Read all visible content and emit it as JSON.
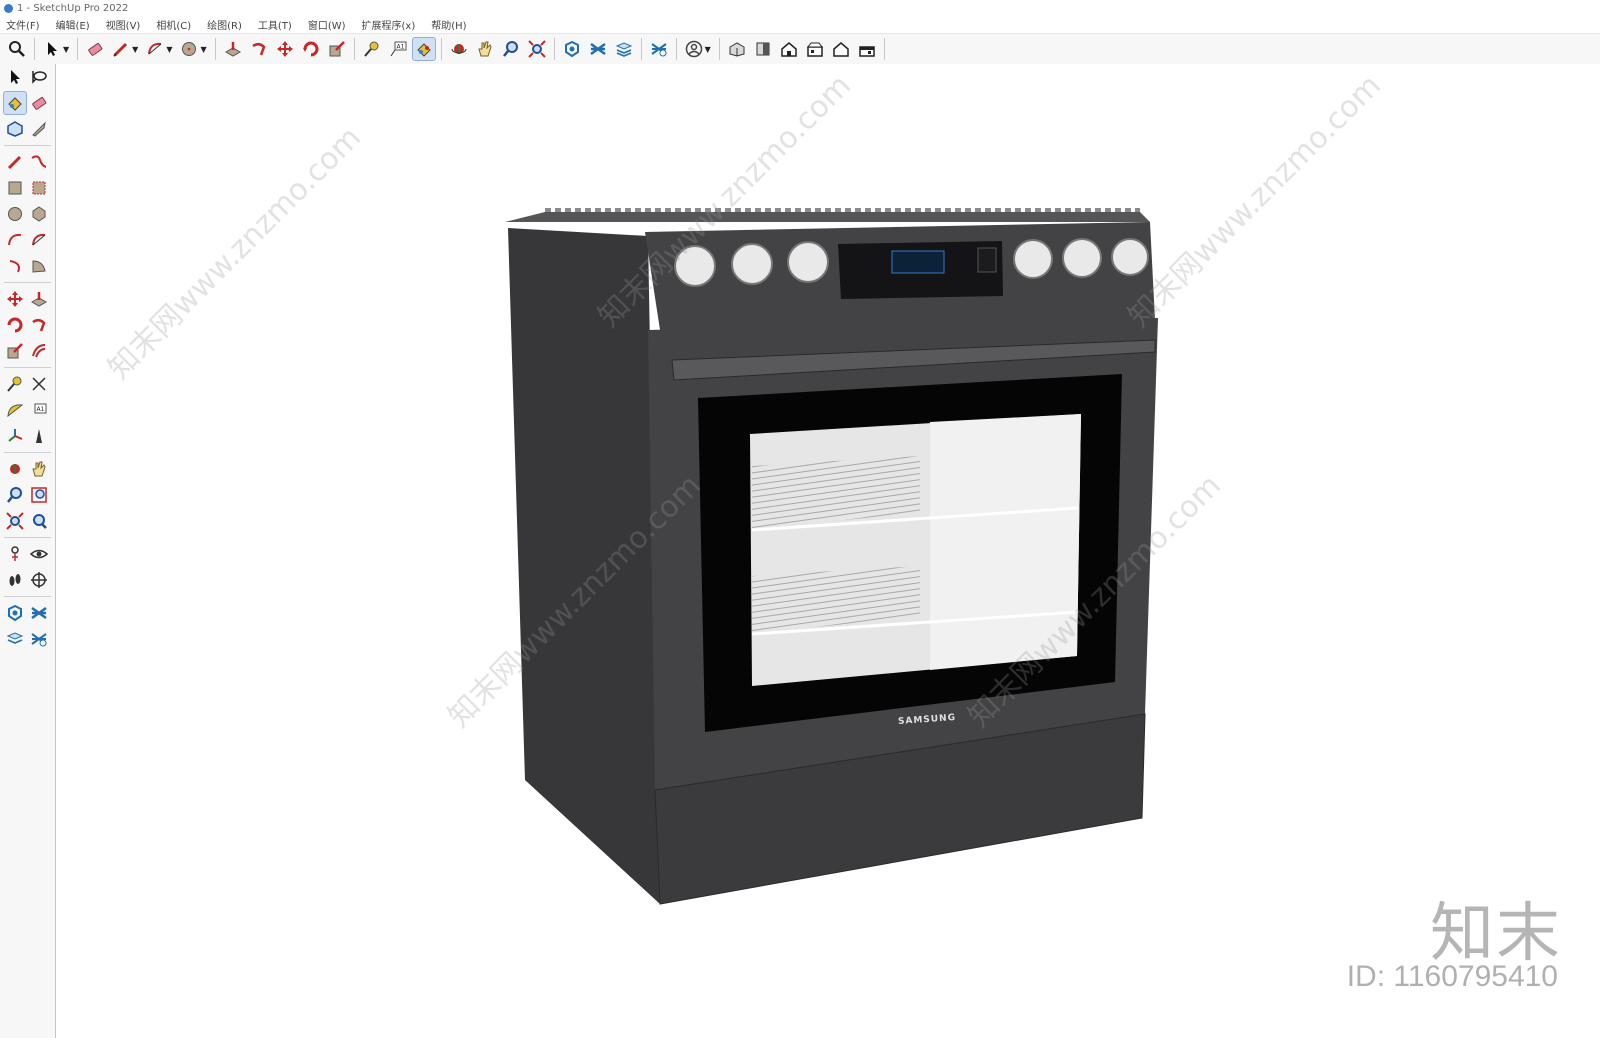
{
  "window": {
    "title": "1 - SketchUp Pro 2022"
  },
  "menu": [
    "文件(F)",
    "编辑(E)",
    "视图(V)",
    "相机(C)",
    "绘图(R)",
    "工具(T)",
    "窗口(W)",
    "扩展程序(x)",
    "帮助(H)"
  ],
  "model": {
    "brand_label": "SAMSUNG"
  },
  "watermark": {
    "url_text": "知末网www.znzmo.com",
    "brand": "知末",
    "id_label": "ID: 1160795410"
  },
  "colors": {
    "toolbar_bg": "#f7f7f7",
    "active_tool": "#cfe0f4",
    "oven_body": "#3d3d40",
    "accent_red": "#c62828"
  }
}
